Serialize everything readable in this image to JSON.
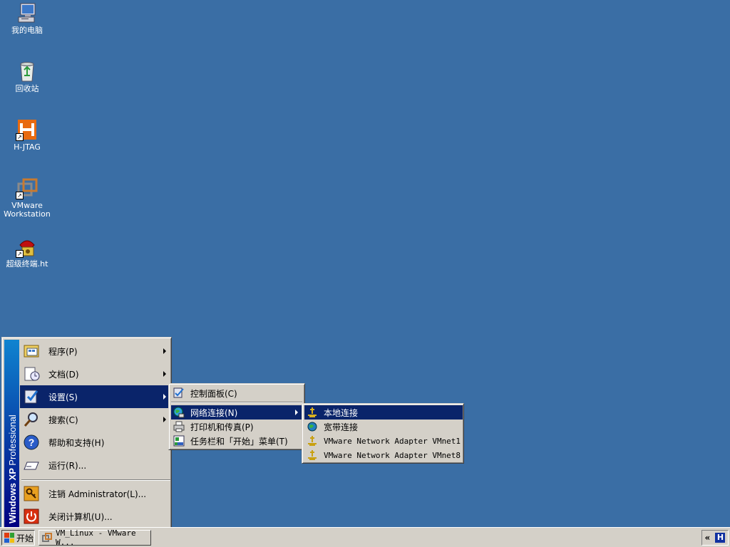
{
  "desktop": {
    "icons": [
      {
        "label": "我的电脑",
        "icon": "my-computer-icon"
      },
      {
        "label": "回收站",
        "icon": "recycle-bin-icon"
      },
      {
        "label": "H-JTAG",
        "icon": "h-jtag-icon"
      },
      {
        "label": "VMware\nWorkstation",
        "icon": "vmware-icon"
      },
      {
        "label": "超级终端.ht",
        "icon": "hyperterminal-icon"
      }
    ]
  },
  "start_menu": {
    "banner_brand": "Windows XP",
    "banner_edition": "Professional",
    "items": [
      {
        "label": "程序(P)"
      },
      {
        "label": "文档(D)"
      },
      {
        "label": "设置(S)"
      },
      {
        "label": "搜索(C)"
      },
      {
        "label": "帮助和支持(H)"
      },
      {
        "label": "运行(R)..."
      },
      {
        "label": "注销 Administrator(L)..."
      },
      {
        "label": "关闭计算机(U)..."
      }
    ]
  },
  "settings_menu": {
    "items": [
      {
        "label": "控制面板(C)"
      },
      {
        "label": "网络连接(N)"
      },
      {
        "label": "打印机和传真(P)"
      },
      {
        "label": "任务栏和「开始」菜单(T)"
      }
    ]
  },
  "network_menu": {
    "items": [
      {
        "label": "本地连接"
      },
      {
        "label": "宽带连接"
      },
      {
        "label": "VMware Network Adapter VMnet1"
      },
      {
        "label": "VMware Network Adapter VMnet8"
      }
    ]
  },
  "taskbar": {
    "start_label": "开始",
    "tasks": [
      {
        "label": "VM_Linux - VMware W..."
      }
    ],
    "tray_expand": "«",
    "tray_app": "H"
  },
  "colors": {
    "desktop": "#3a6ea5",
    "menu_highlight": "#0a246a",
    "menu_face": "#d4d0c8"
  }
}
